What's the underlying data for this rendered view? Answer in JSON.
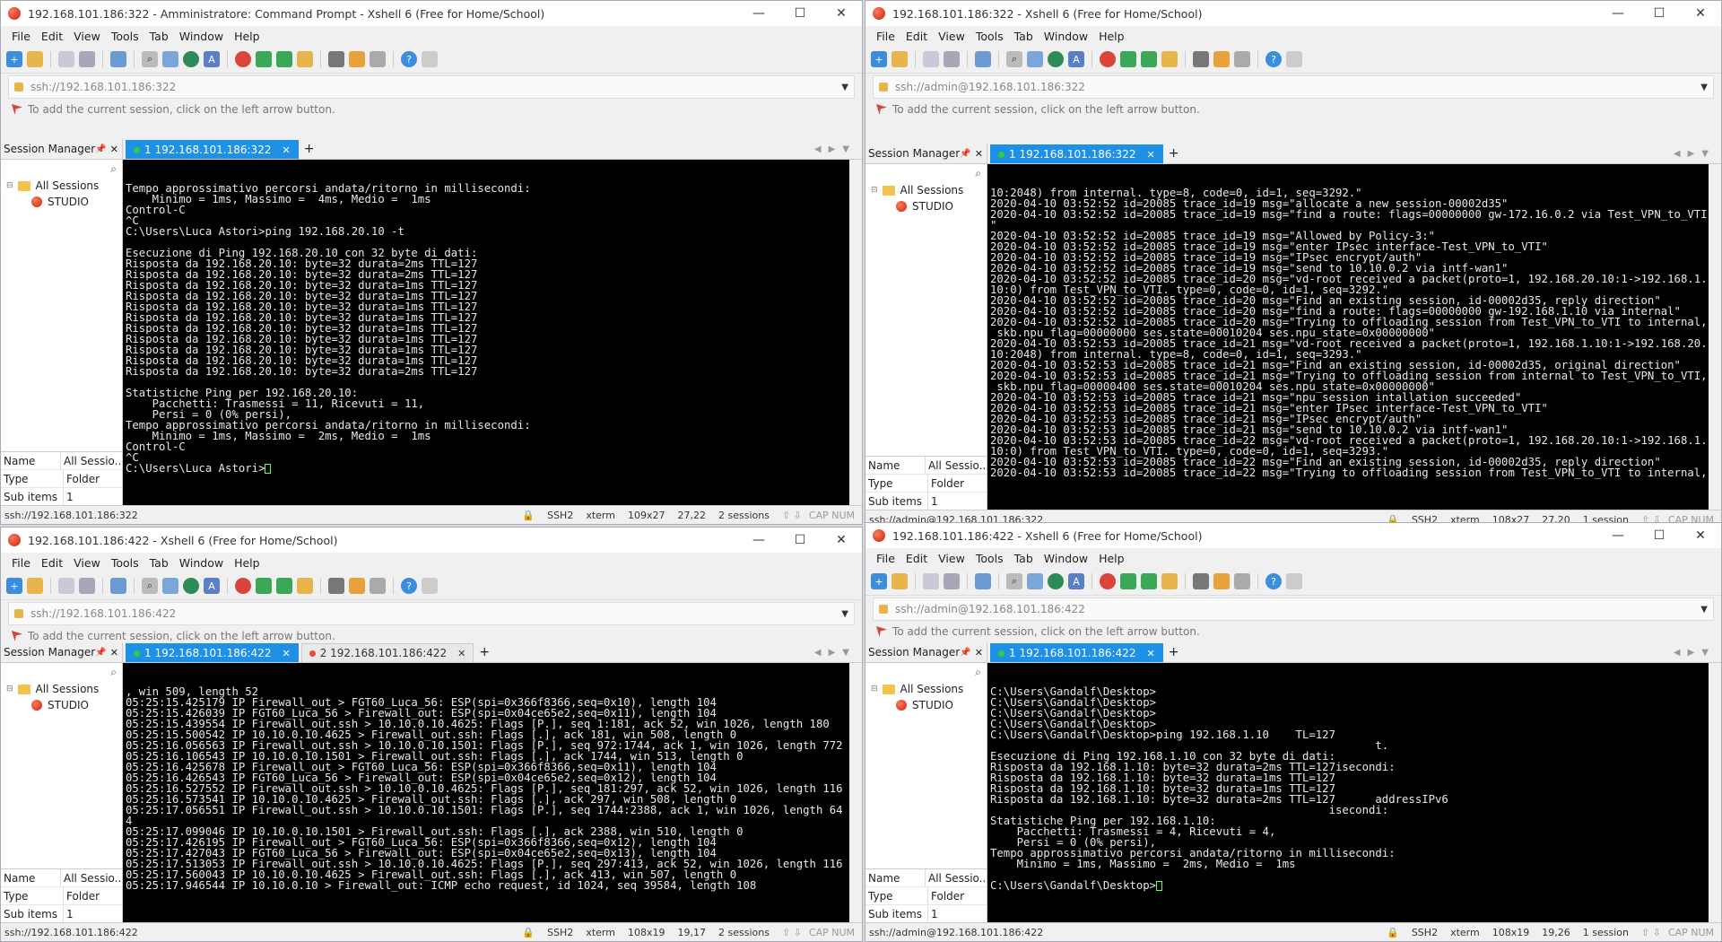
{
  "menu": [
    "File",
    "Edit",
    "View",
    "Tools",
    "Tab",
    "Window",
    "Help"
  ],
  "session_manager": {
    "title": "Session Manager",
    "root": "All Sessions",
    "child": "STUDIO",
    "props": [
      {
        "k": "Name",
        "v": "All Sessio..."
      },
      {
        "k": "Type",
        "v": "Folder"
      },
      {
        "k": "Sub items",
        "v": "1"
      }
    ]
  },
  "hint_text": "To add the current session, click on the left arrow button.",
  "windows": [
    {
      "title": "192.168.101.186:322 - Amministratore: Command Prompt - Xshell 6 (Free for Home/School)",
      "address": "ssh://192.168.101.186:322",
      "tabs": [
        {
          "label": "1 192.168.101.186:322",
          "active": true,
          "dot": "g"
        }
      ],
      "status": {
        "left": "ssh://192.168.101.186:322",
        "proto": "SSH2",
        "term": "xterm",
        "size": "109x27",
        "pos": "27,22",
        "sessions": "2 sessions",
        "caps": "CAP  NUM"
      },
      "lines": [
        "Tempo approssimativo percorsi andata/ritorno in millisecondi:",
        "    Minimo = 1ms, Massimo =  4ms, Medio =  1ms",
        "Control-C",
        "^C",
        "C:\\Users\\Luca Astori>ping 192.168.20.10 -t",
        "",
        "Esecuzione di Ping 192.168.20.10 con 32 byte di dati:",
        "Risposta da 192.168.20.10: byte=32 durata=2ms TTL=127",
        "Risposta da 192.168.20.10: byte=32 durata=2ms TTL=127",
        "Risposta da 192.168.20.10: byte=32 durata=1ms TTL=127",
        "Risposta da 192.168.20.10: byte=32 durata=1ms TTL=127",
        "Risposta da 192.168.20.10: byte=32 durata=1ms TTL=127",
        "Risposta da 192.168.20.10: byte=32 durata=1ms TTL=127",
        "Risposta da 192.168.20.10: byte=32 durata=1ms TTL=127",
        "Risposta da 192.168.20.10: byte=32 durata=1ms TTL=127",
        "Risposta da 192.168.20.10: byte=32 durata=1ms TTL=127",
        "Risposta da 192.168.20.10: byte=32 durata=1ms TTL=127",
        "Risposta da 192.168.20.10: byte=32 durata=2ms TTL=127",
        "",
        "Statistiche Ping per 192.168.20.10:",
        "    Pacchetti: Trasmessi = 11, Ricevuti = 11,",
        "    Persi = 0 (0% persi),",
        "Tempo approssimativo percorsi andata/ritorno in millisecondi:",
        "    Minimo = 1ms, Massimo =  2ms, Medio =  1ms",
        "Control-C",
        "^C",
        "C:\\Users\\Luca Astori>"
      ]
    },
    {
      "title": "192.168.101.186:322 - Xshell 6 (Free for Home/School)",
      "address": "ssh://admin@192.168.101.186:322",
      "tabs": [
        {
          "label": "1 192.168.101.186:322",
          "active": true,
          "dot": "g"
        }
      ],
      "status": {
        "left": "ssh://admin@192.168.101.186:322",
        "proto": "SSH2",
        "term": "xterm",
        "size": "108x27",
        "pos": "27,20",
        "sessions": "1 session",
        "caps": "CAP  NUM"
      },
      "lines": [
        "10:2048) from internal. type=8, code=0, id=1, seq=3292.\"",
        "2020-04-10 03:52:52 id=20085 trace_id=19 msg=\"allocate a new session-00002d35\"",
        "2020-04-10 03:52:52 id=20085 trace_id=19 msg=\"find a route: flags=00000000 gw-172.16.0.2 via Test_VPN_to_VTI",
        "\"",
        "2020-04-10 03:52:52 id=20085 trace_id=19 msg=\"Allowed by Policy-3:\"",
        "2020-04-10 03:52:52 id=20085 trace_id=19 msg=\"enter IPsec interface-Test_VPN_to_VTI\"",
        "2020-04-10 03:52:52 id=20085 trace_id=19 msg=\"IPsec encrypt/auth\"",
        "2020-04-10 03:52:52 id=20085 trace_id=19 msg=\"send to 10.10.0.2 via intf-wan1\"",
        "2020-04-10 03:52:52 id=20085 trace_id=20 msg=\"vd-root received a packet(proto=1, 192.168.20.10:1->192.168.1.",
        "10:0) from Test_VPN_to_VTI. type=0, code=0, id=1, seq=3292.\"",
        "2020-04-10 03:52:52 id=20085 trace_id=20 msg=\"Find an existing session, id-00002d35, reply direction\"",
        "2020-04-10 03:52:52 id=20085 trace_id=20 msg=\"find a route: flags=00000000 gw-192.168.1.10 via internal\"",
        "2020-04-10 03:52:52 id=20085 trace_id=20 msg=\"Trying to offloading session from Test_VPN_to_VTI to internal,",
        " skb.npu_flag=00000000 ses.state=00010204 ses.npu_state=0x00000000\"",
        "2020-04-10 03:52:53 id=20085 trace_id=21 msg=\"vd-root received a packet(proto=1, 192.168.1.10:1->192.168.20.",
        "10:2048) from internal. type=8, code=0, id=1, seq=3293.\"",
        "2020-04-10 03:52:53 id=20085 trace_id=21 msg=\"Find an existing session, id-00002d35, original direction\"",
        "2020-04-10 03:52:53 id=20085 trace_id=21 msg=\"Trying to offloading session from internal to Test_VPN_to_VTI,",
        " skb.npu_flag=00000400 ses.state=00010204 ses.npu_state=0x00000000\"",
        "2020-04-10 03:52:53 id=20085 trace_id=21 msg=\"npu session intallation succeeded\"",
        "2020-04-10 03:52:53 id=20085 trace_id=21 msg=\"enter IPsec interface-Test_VPN_to_VTI\"",
        "2020-04-10 03:52:53 id=20085 trace_id=21 msg=\"IPsec encrypt/auth\"",
        "2020-04-10 03:52:53 id=20085 trace_id=21 msg=\"send to 10.10.0.2 via intf-wan1\"",
        "2020-04-10 03:52:53 id=20085 trace_id=22 msg=\"vd-root received a packet(proto=1, 192.168.20.10:1->192.168.1.",
        "10:0) from Test_VPN_to_VTI. type=0, code=0, id=1, seq=3293.\"",
        "2020-04-10 03:52:53 id=20085 trace_id=22 msg=\"Find an existing session, id-00002d35, reply direction\"",
        "2020-04-10 03:52:53 id=20085 trace_id=22 msg=\"Trying to offloading session from Test_VPN_to_VTI to internal,"
      ]
    },
    {
      "title": "192.168.101.186:422 - Xshell 6 (Free for Home/School)",
      "address": "ssh://192.168.101.186:422",
      "tabs": [
        {
          "label": "1 192.168.101.186:422",
          "active": true,
          "dot": "g"
        },
        {
          "label": "2 192.168.101.186:422",
          "active": false,
          "dot": "r"
        }
      ],
      "status": {
        "left": "ssh://192.168.101.186:422",
        "proto": "SSH2",
        "term": "xterm",
        "size": "108x19",
        "pos": "19,17",
        "sessions": "2 sessions",
        "caps": "CAP  NUM"
      },
      "lines": [
        ", win 509, length 52",
        "05:25:15.425179 IP Firewall_out > FGT60_Luca_56: ESP(spi=0x366f8366,seq=0x10), length 104",
        "05:25:15.426039 IP FGT60_Luca_56 > Firewall_out: ESP(spi=0x04ce65e2,seq=0x11), length 104",
        "05:25:15.439554 IP Firewall_out.ssh > 10.10.0.10.4625: Flags [P.], seq 1:181, ack 52, win 1026, length 180",
        "05:25:15.500542 IP 10.10.0.10.4625 > Firewall_out.ssh: Flags [.], ack 181, win 508, length 0",
        "05:25:16.056563 IP Firewall_out.ssh > 10.10.0.10.1501: Flags [P.], seq 972:1744, ack 1, win 1026, length 772",
        "05:25:16.106543 IP 10.10.0.10.1501 > Firewall_out.ssh: Flags [.], ack 1744, win 513, length 0",
        "05:25:16.425678 IP Firewall_out > FGT60_Luca_56: ESP(spi=0x366f8366,seq=0x11), length 104",
        "05:25:16.426543 IP FGT60_Luca_56 > Firewall_out: ESP(spi=0x04ce65e2,seq=0x12), length 104",
        "05:25:16.527552 IP Firewall_out.ssh > 10.10.0.10.4625: Flags [P.], seq 181:297, ack 52, win 1026, length 116",
        "05:25:16.573541 IP 10.10.0.10.4625 > Firewall_out.ssh: Flags [.], ack 297, win 508, length 0",
        "05:25:17.056551 IP Firewall_out.ssh > 10.10.0.10.1501: Flags [P.], seq 1744:2388, ack 1, win 1026, length 64",
        "4",
        "05:25:17.099046 IP 10.10.0.10.1501 > Firewall_out.ssh: Flags [.], ack 2388, win 510, length 0",
        "05:25:17.426195 IP Firewall_out > FGT60_Luca_56: ESP(spi=0x366f8366,seq=0x12), length 104",
        "05:25:17.427043 IP FGT60_Luca_56 > Firewall_out: ESP(spi=0x04ce65e2,seq=0x13), length 104",
        "05:25:17.513053 IP Firewall_out.ssh > 10.10.0.10.4625: Flags [P.], seq 297:413, ack 52, win 1026, length 116",
        "05:25:17.560043 IP 10.10.0.10.4625 > Firewall_out.ssh: Flags [.], ack 413, win 507, length 0",
        "05:25:17.946544 IP 10.10.0.10 > Firewall_out: ICMP echo request, id 1024, seq 39584, length 108"
      ]
    },
    {
      "title": "192.168.101.186:422 - Xshell 6 (Free for Home/School)",
      "address": "ssh://admin@192.168.101.186:422",
      "tabs": [
        {
          "label": "1 192.168.101.186:422",
          "active": true,
          "dot": "g"
        }
      ],
      "status": {
        "left": "ssh://admin@192.168.101.186:422",
        "proto": "SSH2",
        "term": "xterm",
        "size": "108x19",
        "pos": "19,26",
        "sessions": "1 session",
        "caps": "CAP  NUM"
      },
      "lines": [
        "C:\\Users\\Gandalf\\Desktop>",
        "C:\\Users\\Gandalf\\Desktop>",
        "C:\\Users\\Gandalf\\Desktop>",
        "C:\\Users\\Gandalf\\Desktop>",
        "C:\\Users\\Gandalf\\Desktop>ping 192.168.1.10    TL=127",
        "                                                          t.",
        "Esecuzione di Ping 192.168.1.10 con 32 byte di dati:",
        "Risposta da 192.168.1.10: byte=32 durata=2ms TTL=127isecondi:",
        "Risposta da 192.168.1.10: byte=32 durata=1ms TTL=127",
        "Risposta da 192.168.1.10: byte=32 durata=1ms TTL=127",
        "Risposta da 192.168.1.10: byte=32 durata=2ms TTL=127      addressIPv6",
        "                                                   isecondi:",
        "Statistiche Ping per 192.168.1.10:",
        "    Pacchetti: Trasmessi = 4, Ricevuti = 4,",
        "    Persi = 0 (0% persi),",
        "Tempo approssimativo percorsi andata/ritorno in millisecondi:",
        "    Minimo = 1ms, Massimo =  2ms, Medio =  1ms",
        "",
        "C:\\Users\\Gandalf\\Desktop>"
      ]
    }
  ]
}
